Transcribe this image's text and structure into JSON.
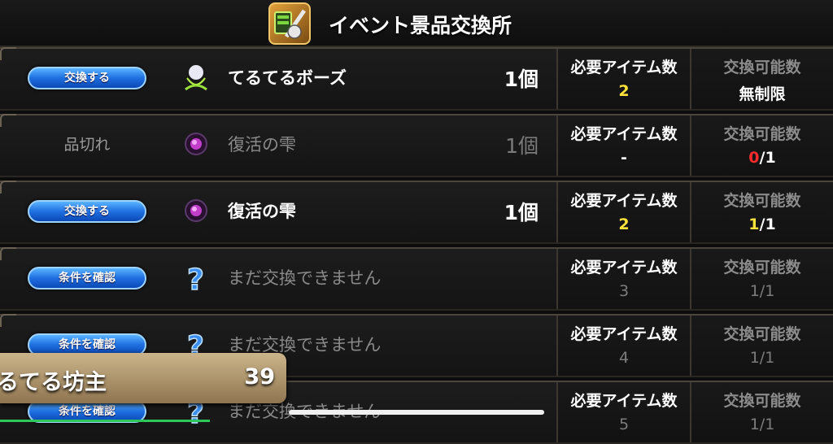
{
  "header": {
    "title": "イベント景品交換所",
    "icon": "event-shop-icon"
  },
  "labels": {
    "required": "必要アイテム数",
    "available": "交換可能数"
  },
  "rows": [
    {
      "action": "交換する",
      "action_type": "exchange",
      "icon": "teru-doll-icon",
      "name": "てるてるボーズ",
      "qty": "1個",
      "required": "2",
      "avail": "無制限"
    },
    {
      "action": "品切れ",
      "action_type": "soldout",
      "icon": "orb-icon",
      "name": "復活の雫",
      "qty": "1個",
      "required": "-",
      "avail_used": "0",
      "avail_total": "/1"
    },
    {
      "action": "交換する",
      "action_type": "exchange",
      "icon": "orb-icon",
      "name": "復活の雫",
      "qty": "1個",
      "required": "2",
      "avail_used": "1",
      "avail_total": "/1"
    },
    {
      "action": "条件を確認",
      "action_type": "check",
      "icon": "question-icon",
      "name": "まだ交換できません",
      "required": "3",
      "avail": "1/1"
    },
    {
      "action": "条件を確認",
      "action_type": "check",
      "icon": "question-icon",
      "name": "まだ交換できません",
      "required": "4",
      "avail": "1/1"
    },
    {
      "action": "条件を確認",
      "action_type": "check",
      "icon": "question-icon",
      "name": "まだ交換できません",
      "required": "5",
      "avail": "1/1"
    }
  ],
  "player": {
    "name": "るてる坊主",
    "level": "39"
  }
}
